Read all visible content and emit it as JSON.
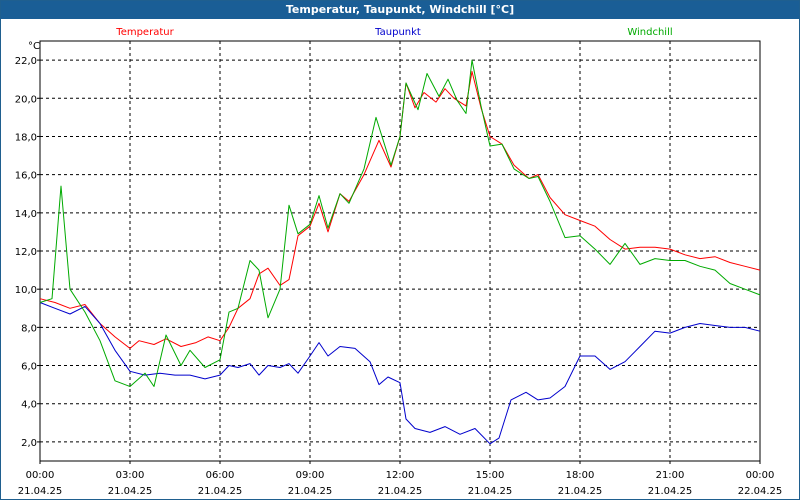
{
  "window": {
    "title": "Temperatur, Taupunkt, Windchill [°C]"
  },
  "chart_data": {
    "type": "line",
    "unit": "°C",
    "ylim": [
      1.0,
      23.0
    ],
    "yticks": [
      2.0,
      4.0,
      6.0,
      8.0,
      10.0,
      12.0,
      14.0,
      16.0,
      18.0,
      20.0,
      22.0
    ],
    "ytick_labels": [
      "2,0",
      "4,0",
      "6,0",
      "8,0",
      "10,0",
      "12,0",
      "14,0",
      "16,0",
      "18,0",
      "20,0",
      "22,0"
    ],
    "xlim": [
      0,
      24
    ],
    "xticks": [
      0,
      3,
      6,
      9,
      12,
      15,
      18,
      21,
      24
    ],
    "xtick_times": [
      "00:00",
      "03:00",
      "06:00",
      "09:00",
      "12:00",
      "15:00",
      "18:00",
      "21:00",
      "00:00"
    ],
    "xtick_dates": [
      "21.04.25",
      "21.04.25",
      "21.04.25",
      "21.04.25",
      "21.04.25",
      "21.04.25",
      "21.04.25",
      "21.04.25",
      "22.04.25"
    ],
    "grid": true,
    "legend_position": "top",
    "series": [
      {
        "name": "Temperatur",
        "color": "#ff0000",
        "points": [
          [
            0,
            9.5
          ],
          [
            0.5,
            9.3
          ],
          [
            1,
            9.0
          ],
          [
            1.5,
            9.2
          ],
          [
            2,
            8.2
          ],
          [
            2.5,
            7.5
          ],
          [
            3,
            6.9
          ],
          [
            3.3,
            7.3
          ],
          [
            3.8,
            7.1
          ],
          [
            4.2,
            7.4
          ],
          [
            4.7,
            7.0
          ],
          [
            5.2,
            7.2
          ],
          [
            5.6,
            7.5
          ],
          [
            6,
            7.3
          ],
          [
            6.3,
            8.0
          ],
          [
            6.6,
            9.0
          ],
          [
            7,
            9.5
          ],
          [
            7.3,
            10.8
          ],
          [
            7.6,
            11.1
          ],
          [
            8,
            10.2
          ],
          [
            8.3,
            10.5
          ],
          [
            8.6,
            12.8
          ],
          [
            9,
            13.3
          ],
          [
            9.3,
            14.5
          ],
          [
            9.6,
            13.0
          ],
          [
            10,
            15.0
          ],
          [
            10.3,
            14.6
          ],
          [
            10.8,
            16.0
          ],
          [
            11.3,
            17.8
          ],
          [
            11.7,
            16.4
          ],
          [
            12,
            18.0
          ],
          [
            12.2,
            20.8
          ],
          [
            12.5,
            19.5
          ],
          [
            12.8,
            20.3
          ],
          [
            13.2,
            19.8
          ],
          [
            13.5,
            20.5
          ],
          [
            13.8,
            20.0
          ],
          [
            14.2,
            19.6
          ],
          [
            14.4,
            21.4
          ],
          [
            14.7,
            19.5
          ],
          [
            15,
            18.0
          ],
          [
            15.4,
            17.6
          ],
          [
            15.8,
            16.5
          ],
          [
            16.3,
            15.8
          ],
          [
            16.6,
            16.0
          ],
          [
            17,
            14.8
          ],
          [
            17.5,
            13.9
          ],
          [
            18,
            13.6
          ],
          [
            18.5,
            13.3
          ],
          [
            19,
            12.6
          ],
          [
            19.5,
            12.1
          ],
          [
            20,
            12.2
          ],
          [
            20.5,
            12.2
          ],
          [
            21,
            12.1
          ],
          [
            21.5,
            11.8
          ],
          [
            22,
            11.6
          ],
          [
            22.5,
            11.7
          ],
          [
            23,
            11.4
          ],
          [
            23.5,
            11.2
          ],
          [
            24,
            11.0
          ]
        ]
      },
      {
        "name": "Taupunkt",
        "color": "#0000cc",
        "points": [
          [
            0,
            9.3
          ],
          [
            0.5,
            9.0
          ],
          [
            1,
            8.7
          ],
          [
            1.5,
            9.1
          ],
          [
            2,
            8.2
          ],
          [
            2.5,
            6.8
          ],
          [
            3,
            5.7
          ],
          [
            3.5,
            5.5
          ],
          [
            4,
            5.6
          ],
          [
            4.5,
            5.5
          ],
          [
            5,
            5.5
          ],
          [
            5.5,
            5.3
          ],
          [
            6,
            5.5
          ],
          [
            6.3,
            6.0
          ],
          [
            6.6,
            5.9
          ],
          [
            7,
            6.1
          ],
          [
            7.3,
            5.5
          ],
          [
            7.6,
            6.0
          ],
          [
            8,
            5.9
          ],
          [
            8.3,
            6.1
          ],
          [
            8.6,
            5.6
          ],
          [
            9,
            6.5
          ],
          [
            9.3,
            7.2
          ],
          [
            9.6,
            6.5
          ],
          [
            10,
            7.0
          ],
          [
            10.5,
            6.9
          ],
          [
            11,
            6.2
          ],
          [
            11.3,
            5.0
          ],
          [
            11.6,
            5.4
          ],
          [
            12,
            5.1
          ],
          [
            12.2,
            3.2
          ],
          [
            12.5,
            2.7
          ],
          [
            13,
            2.5
          ],
          [
            13.5,
            2.8
          ],
          [
            14,
            2.4
          ],
          [
            14.5,
            2.7
          ],
          [
            15,
            1.9
          ],
          [
            15.3,
            2.2
          ],
          [
            15.7,
            4.2
          ],
          [
            16.2,
            4.6
          ],
          [
            16.6,
            4.2
          ],
          [
            17,
            4.3
          ],
          [
            17.5,
            4.9
          ],
          [
            18,
            6.5
          ],
          [
            18.5,
            6.5
          ],
          [
            19,
            5.8
          ],
          [
            19.5,
            6.2
          ],
          [
            20,
            7.0
          ],
          [
            20.5,
            7.8
          ],
          [
            21,
            7.7
          ],
          [
            21.5,
            8.0
          ],
          [
            22,
            8.2
          ],
          [
            22.5,
            8.1
          ],
          [
            23,
            8.0
          ],
          [
            23.5,
            8.0
          ],
          [
            24,
            7.8
          ]
        ]
      },
      {
        "name": "Windchill",
        "color": "#00aa00",
        "points": [
          [
            0,
            9.3
          ],
          [
            0.4,
            9.5
          ],
          [
            0.7,
            15.4
          ],
          [
            1,
            10.0
          ],
          [
            1.5,
            8.8
          ],
          [
            2,
            7.3
          ],
          [
            2.5,
            5.2
          ],
          [
            3,
            4.9
          ],
          [
            3.5,
            5.6
          ],
          [
            3.8,
            4.9
          ],
          [
            4.2,
            7.6
          ],
          [
            4.7,
            6.0
          ],
          [
            5,
            6.8
          ],
          [
            5.5,
            5.9
          ],
          [
            6,
            6.3
          ],
          [
            6.3,
            8.8
          ],
          [
            6.6,
            9.0
          ],
          [
            7,
            11.5
          ],
          [
            7.3,
            11.0
          ],
          [
            7.6,
            8.5
          ],
          [
            8,
            10.0
          ],
          [
            8.3,
            14.4
          ],
          [
            8.6,
            12.9
          ],
          [
            9,
            13.4
          ],
          [
            9.3,
            14.9
          ],
          [
            9.6,
            13.2
          ],
          [
            10,
            15.0
          ],
          [
            10.3,
            14.5
          ],
          [
            10.8,
            16.3
          ],
          [
            11.2,
            19.0
          ],
          [
            11.7,
            16.5
          ],
          [
            12,
            18.0
          ],
          [
            12.2,
            20.8
          ],
          [
            12.6,
            19.4
          ],
          [
            12.9,
            21.3
          ],
          [
            13.3,
            20.1
          ],
          [
            13.6,
            21.0
          ],
          [
            13.9,
            19.9
          ],
          [
            14.2,
            19.2
          ],
          [
            14.4,
            22.0
          ],
          [
            14.7,
            19.6
          ],
          [
            15,
            17.5
          ],
          [
            15.4,
            17.6
          ],
          [
            15.8,
            16.3
          ],
          [
            16.3,
            15.8
          ],
          [
            16.6,
            15.9
          ],
          [
            17,
            14.6
          ],
          [
            17.5,
            12.7
          ],
          [
            18,
            12.8
          ],
          [
            18.5,
            12.1
          ],
          [
            19,
            11.3
          ],
          [
            19.5,
            12.4
          ],
          [
            20,
            11.3
          ],
          [
            20.5,
            11.6
          ],
          [
            21,
            11.5
          ],
          [
            21.5,
            11.5
          ],
          [
            22,
            11.2
          ],
          [
            22.5,
            11.0
          ],
          [
            23,
            10.3
          ],
          [
            23.5,
            10.0
          ],
          [
            24,
            9.7
          ]
        ]
      }
    ]
  }
}
